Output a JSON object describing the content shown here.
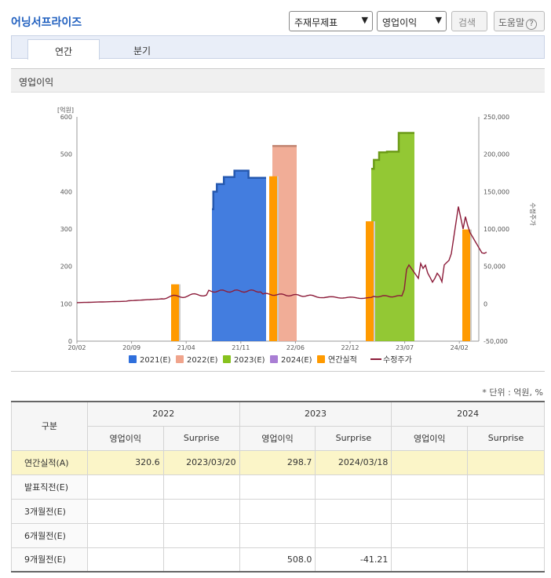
{
  "header": {
    "title": "어닝서프라이즈",
    "select1": "주재무제표",
    "select2": "영업이익",
    "search_label": "검색",
    "help_label": "도움말",
    "help_icon": "?"
  },
  "tabs": [
    {
      "label": "연간",
      "active": true
    },
    {
      "label": "분기",
      "active": false
    }
  ],
  "chart_head_label": "영업이익",
  "chart_data": {
    "type": "bar",
    "left_axis_label": "[억원]",
    "right_axis_label": "수정주가",
    "left_ylim": [
      0,
      600
    ],
    "right_ylim": [
      -50000,
      250000
    ],
    "left_ticks": [
      "0",
      "100",
      "200",
      "300",
      "400",
      "500",
      "600"
    ],
    "right_ticks": [
      "-50,000",
      "0",
      "50,000",
      "100,000",
      "150,000",
      "200,000",
      "250,000"
    ],
    "x_ticks": [
      "20/02",
      "20/09",
      "21/04",
      "21/11",
      "22/06",
      "22/12",
      "23/07",
      "24/02"
    ],
    "estimate_series": [
      {
        "name": "2021(E)",
        "color": "#2f6fdc",
        "steps": [
          [
            353,
            2
          ],
          [
            400,
            5
          ],
          [
            420,
            10
          ],
          [
            439,
            15
          ],
          [
            456,
            20
          ],
          [
            437,
            25
          ]
        ]
      },
      {
        "name": "2022(E)",
        "color": "#f0a48c",
        "steps": [
          [
            522,
            1
          ]
        ]
      },
      {
        "name": "2023(E)",
        "color": "#87c21e",
        "steps": [
          [
            461,
            2
          ],
          [
            485,
            4
          ],
          [
            505,
            6
          ],
          [
            507,
            9
          ],
          [
            557,
            12
          ]
        ]
      }
    ],
    "actual_bars": [
      {
        "x": "20/12",
        "value": 152
      },
      {
        "x": "22/02",
        "value": 441
      },
      {
        "x": "23/02",
        "value": 320.6
      },
      {
        "x": "24/03",
        "value": 298.7
      }
    ],
    "legend": [
      {
        "name": "2021(E)",
        "color": "#2f6fdc",
        "kind": "box"
      },
      {
        "name": "2022(E)",
        "color": "#f0a48c",
        "kind": "box"
      },
      {
        "name": "2023(E)",
        "color": "#87c21e",
        "kind": "box"
      },
      {
        "name": "2024(E)",
        "color": "#a97ed4",
        "kind": "box"
      },
      {
        "name": "연간실적",
        "color": "#ff9a00",
        "kind": "box"
      },
      {
        "name": "수정주가",
        "color": "#8c1c3a",
        "kind": "line"
      }
    ]
  },
  "unit_note": "* 단위 : 억원, %",
  "table": {
    "corner": "구분",
    "years": [
      "2022",
      "2023",
      "2024"
    ],
    "sub_headers": [
      "영업이익",
      "Surprise",
      "영업이익",
      "Surprise",
      "영업이익",
      "Surprise"
    ],
    "rows": [
      {
        "label": "연간실적(A)",
        "cells": [
          "320.6",
          "2023/03/20",
          "298.7",
          "2024/03/18",
          "",
          ""
        ],
        "highlight": true
      },
      {
        "label": "발표직전(E)",
        "cells": [
          "",
          "",
          "",
          "",
          "",
          ""
        ]
      },
      {
        "label": "3개월전(E)",
        "cells": [
          "",
          "",
          "",
          "",
          "",
          ""
        ]
      },
      {
        "label": "6개월전(E)",
        "cells": [
          "",
          "",
          "",
          "",
          "",
          ""
        ]
      },
      {
        "label": "9개월전(E)",
        "cells": [
          "",
          "",
          "508.0",
          "-41.21",
          "",
          ""
        ]
      }
    ]
  }
}
